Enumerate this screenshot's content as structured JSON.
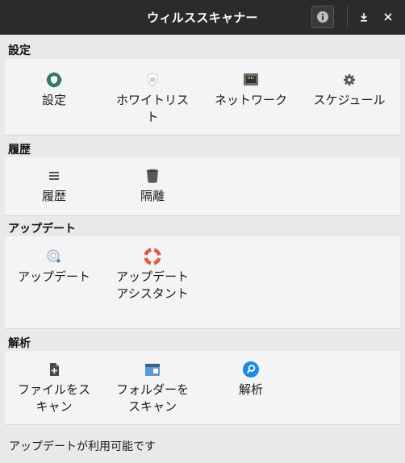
{
  "window": {
    "title": "ウィルススキャナー"
  },
  "sections": [
    {
      "header": "設定",
      "items": [
        {
          "label": "設定",
          "icon": "shield-gear-icon"
        },
        {
          "label": "ホワイトリスト",
          "icon": "whitelist-shield-icon"
        },
        {
          "label": "ネットワーク",
          "icon": "network-port-icon"
        },
        {
          "label": "スケジュール",
          "icon": "gear-icon"
        }
      ]
    },
    {
      "header": "履歴",
      "items": [
        {
          "label": "履歴",
          "icon": "list-icon"
        },
        {
          "label": "隔離",
          "icon": "trash-can-icon"
        }
      ]
    },
    {
      "header": "アップデート",
      "items": [
        {
          "label": "アップデート",
          "icon": "update-icon"
        },
        {
          "label": "アップデートアシスタント",
          "icon": "lifebuoy-icon"
        }
      ]
    },
    {
      "header": "解析",
      "items": [
        {
          "label": "ファイルをスキャン",
          "icon": "scan-file-icon"
        },
        {
          "label": "フォルダーをスキャン",
          "icon": "scan-folder-icon"
        },
        {
          "label": "解析",
          "icon": "magnifier-icon"
        }
      ]
    }
  ],
  "status": "アップデートが利用可能です",
  "colors": {
    "titlebar": "#2b2b2b",
    "panel": "#f4f4f7",
    "background": "#e9e9ec",
    "accent_green": "#2e7d5b",
    "accent_blue": "#1e88e5",
    "accent_red": "#e05a47"
  }
}
